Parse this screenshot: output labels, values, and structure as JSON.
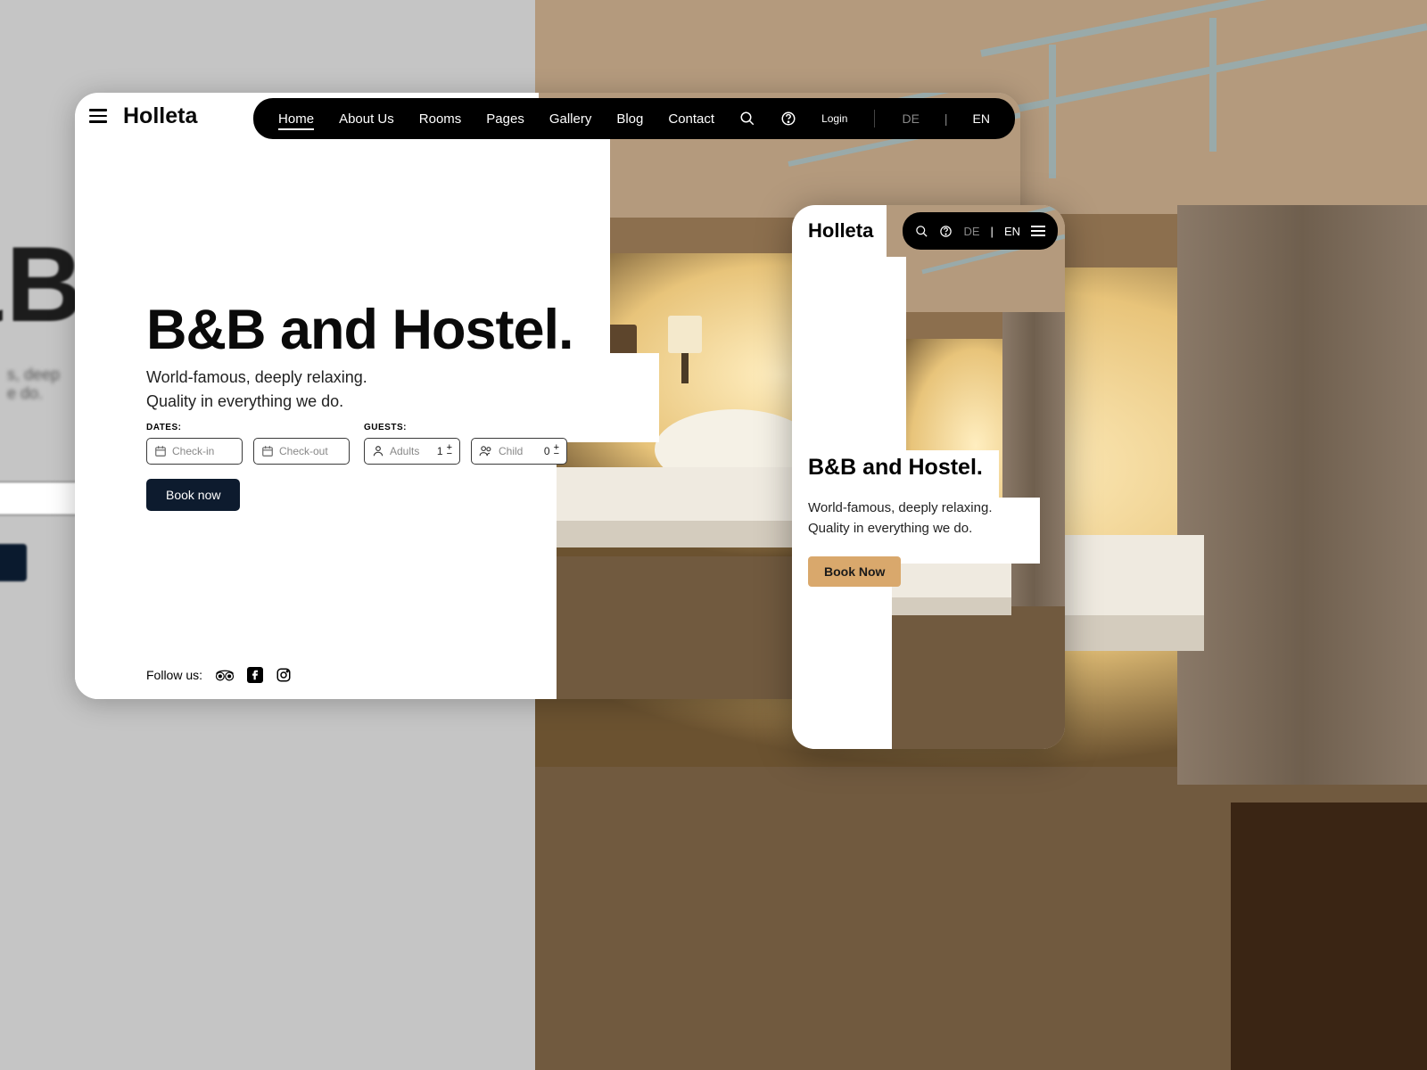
{
  "brand": "Holleta",
  "nav": {
    "items": [
      "Home",
      "About Us",
      "Rooms",
      "Pages",
      "Gallery",
      "Blog",
      "Contact"
    ],
    "login": "Login",
    "lang_inactive": "DE",
    "lang_sep": "|",
    "lang_active": "EN"
  },
  "hero": {
    "title": "B&B and Hostel.",
    "subtitle": "World-famous, deeply relaxing. Quality in everything we do."
  },
  "form": {
    "dates_label": "DATES:",
    "guests_label": "GUESTS:",
    "checkin": "Check-in",
    "checkout": "Check-out",
    "adults_label": "Adults",
    "adults_value": "1",
    "child_label": "Child",
    "child_value": "0",
    "book": "Book now"
  },
  "social": {
    "label": "Follow us:"
  },
  "mobile": {
    "lang_inactive": "DE",
    "lang_sep": "|",
    "lang_active": "EN",
    "book": "Book Now"
  },
  "ghost": {
    "title": "&B",
    "sub": "s, deep\ne do."
  }
}
